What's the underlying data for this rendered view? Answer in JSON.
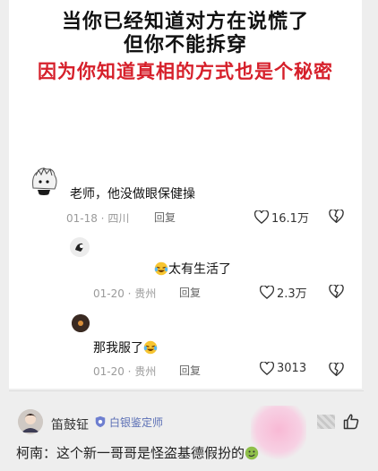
{
  "headline": {
    "line1": "当你已经知道对方在说慌了",
    "line2": "但你不能拆穿",
    "line3": "因为你知道真相的方式也是个秘密"
  },
  "comments": [
    {
      "text": "老师，他没做眼保健操",
      "date": "01-18 · 四川",
      "reply": "回复",
      "likes": "16.1万"
    },
    {
      "text": "太有生活了",
      "date": "01-20 · 贵州",
      "reply": "回复",
      "likes": "2.3万"
    },
    {
      "text": "那我服了",
      "date": "01-20 · 贵州",
      "reply": "回复",
      "likes": "3013"
    }
  ],
  "bottom": {
    "username": "笛鼓钲",
    "badge": "白银鉴定师",
    "text": "柯南：这个新一哥哥是怪盗基德假扮的"
  },
  "colors": {
    "red": "#d6202b",
    "badge": "#5b6fb5"
  },
  "icons": [
    "heart-icon",
    "broken-heart-icon",
    "laughing-cry-emoji",
    "shield-badge-icon",
    "thumb-up-icon"
  ]
}
